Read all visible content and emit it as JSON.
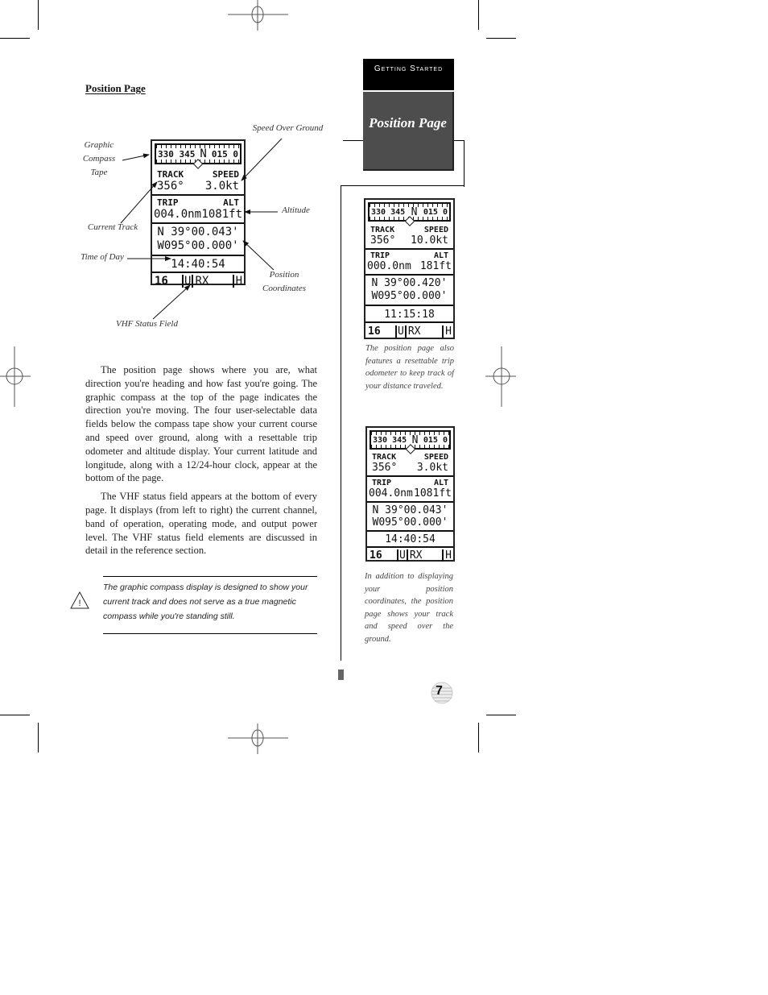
{
  "section": {
    "heading": "Position Page",
    "tab_category": "Getting Started",
    "tab_title": "Position Page"
  },
  "diagram": {
    "callouts": {
      "compass_tape": "Graphic\nCompass\nTape",
      "speed_over_ground": "Speed Over Ground",
      "altitude": "Altitude",
      "current_track": "Current Track",
      "time_of_day": "Time of Day",
      "position_coordinates": "Position\nCoordinates",
      "vhf_status_field": "VHF Status Field"
    }
  },
  "screens": [
    {
      "compass": {
        "left": "330 345",
        "center": "N",
        "right": "015 0"
      },
      "track_label": "TRACK",
      "speed_label": "SPEED",
      "track_value": "356°",
      "speed_value": "3.0kt",
      "trip_label": "TRIP",
      "alt_label": "ALT",
      "trip_value": "004.0nm",
      "alt_value": "1081ft",
      "lat": "N 39°00.043'",
      "lon": "W095°00.000'",
      "time": "14:40:54",
      "status": {
        "channel": "16",
        "band": "U",
        "mode": "RX",
        "power": "H"
      }
    },
    {
      "compass": {
        "left": "330 345",
        "center": "N",
        "right": "015 0"
      },
      "track_label": "TRACK",
      "speed_label": "SPEED",
      "track_value": "356°",
      "speed_value": "10.0kt",
      "trip_label": "TRIP",
      "alt_label": "ALT",
      "trip_value": "000.0nm",
      "alt_value": "181ft",
      "lat": "N 39°00.420'",
      "lon": "W095°00.000'",
      "time": "11:15:18",
      "status": {
        "channel": "16",
        "band": "U",
        "mode": "RX",
        "power": "H"
      }
    },
    {
      "compass": {
        "left": "330 345",
        "center": "N",
        "right": "015 0"
      },
      "track_label": "TRACK",
      "speed_label": "SPEED",
      "track_value": "356°",
      "speed_value": "3.0kt",
      "trip_label": "TRIP",
      "alt_label": "ALT",
      "trip_value": "004.0nm",
      "alt_value": "1081ft",
      "lat": "N 39°00.043'",
      "lon": "W095°00.000'",
      "time": "14:40:54",
      "status": {
        "channel": "16",
        "band": "U",
        "mode": "RX",
        "power": "H"
      }
    }
  ],
  "body": {
    "paragraphs": [
      "The position page shows where you are, what direction you're heading and how fast you're going. The graphic compass at the top of the page indicates the direction you're moving. The four user-selectable data fields below the compass tape show your current course and speed over ground, along with a resettable trip odometer and altitude display. Your current latitude and longitude, along with a 12/24-hour clock, appear at the bottom of the page.",
      "The VHF status field appears at the bottom of every page. It displays (from left to right) the current channel, band of operation, operating mode, and output power level. The VHF status field elements are discussed in detail in the reference section."
    ],
    "note": "The graphic compass display is designed to show your current track and does not serve as a true magnetic compass while you're standing still."
  },
  "captions": {
    "screen_2": "The position page also features a resettable trip odometer to keep track of your distance traveled.",
    "screen_3": "In addition to displaying your position coordinates, the position page shows your track and speed over the ground."
  },
  "page_number": "7",
  "icons": {
    "warning": "warning-triangle-icon",
    "page_globe": "globe-icon",
    "registration": "registration-mark-icon"
  }
}
